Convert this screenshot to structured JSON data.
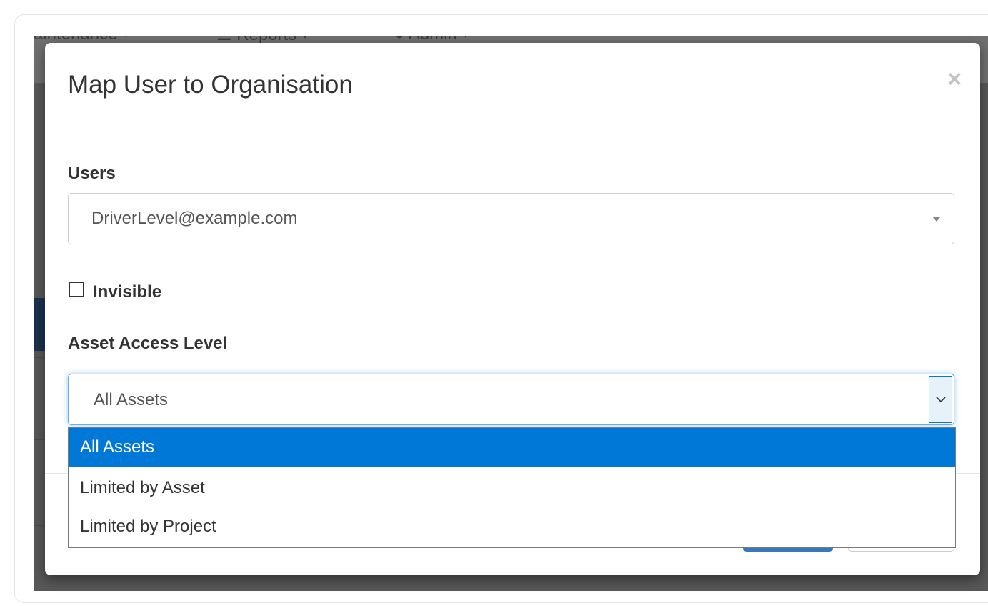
{
  "background": {
    "nav_items": [
      {
        "label": "aintenance",
        "icon": "caret-down-icon"
      },
      {
        "label": "Reports",
        "icon": "list-icon"
      },
      {
        "label": "Admin",
        "icon": "user-icon"
      }
    ]
  },
  "modal": {
    "title": "Map User to Organisation",
    "close_label": "×",
    "users": {
      "label": "Users",
      "value": "DriverLevel@example.com"
    },
    "invisible": {
      "label": "Invisible",
      "checked": false
    },
    "asset_access": {
      "label": "Asset Access Level",
      "value": "All Assets",
      "options": [
        "All Assets",
        "Limited by Asset",
        "Limited by Project"
      ],
      "selected_index": 0
    }
  },
  "colors": {
    "accent": "#0078d7",
    "focus_ring": "#66afe9",
    "primary_button": "#337ab7",
    "backdrop": "#585858"
  }
}
